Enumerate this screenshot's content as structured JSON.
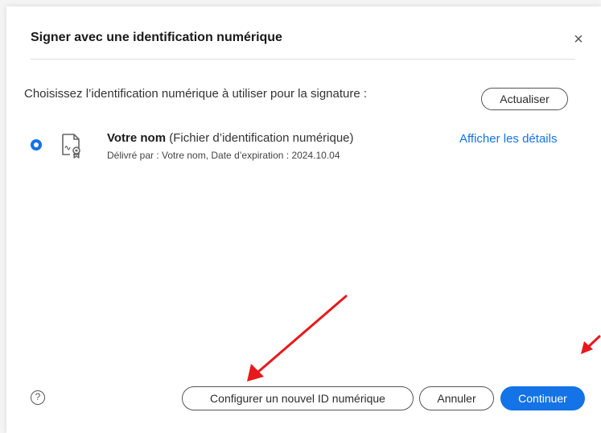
{
  "dialog": {
    "title": "Signer avec une identification numérique",
    "close_glyph": "×",
    "prompt": "Choisissez l’identification numérique à utiliser pour la signature :",
    "refresh_label": "Actualiser"
  },
  "identity": {
    "selected": true,
    "name": "Votre nom",
    "type": "(Fichier d’identification numérique)",
    "details": "Délivré par : Votre nom, Date d’expiration : 2024.10.04",
    "details_link": "Afficher les détails",
    "icon": "certificate-icon"
  },
  "footer": {
    "help_glyph": "?",
    "configure_label": "Configurer un nouvel ID numérique",
    "cancel_label": "Annuler",
    "continue_label": "Continuer"
  },
  "colors": {
    "accent": "#1473e6",
    "annotation_arrow": "#e8191b"
  }
}
